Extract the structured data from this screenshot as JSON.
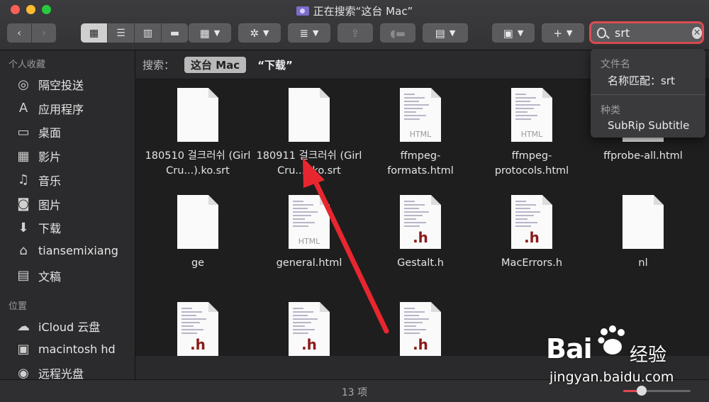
{
  "window": {
    "title": "正在搜索“这台 Mac”",
    "traffic_lights": [
      "#ff5f57",
      "#febc2e",
      "#28c840"
    ]
  },
  "toolbar": {
    "back_icon": "chevron-left",
    "forward_icon": "chevron-right",
    "view_modes": [
      "icon-view",
      "list-view",
      "column-view",
      "gallery-view"
    ],
    "active_view": "icon-view",
    "search": {
      "value": "srt",
      "placeholder": "搜索"
    }
  },
  "sidebar": {
    "favorites_header": "个人收藏",
    "favorites": [
      {
        "label": "隔空投送",
        "icon": "airdrop-icon",
        "glyph": "◎"
      },
      {
        "label": "应用程序",
        "icon": "applications-icon",
        "glyph": "A"
      },
      {
        "label": "桌面",
        "icon": "desktop-icon",
        "glyph": "▭"
      },
      {
        "label": "影片",
        "icon": "movies-icon",
        "glyph": "▦"
      },
      {
        "label": "音乐",
        "icon": "music-icon",
        "glyph": "♫"
      },
      {
        "label": "图片",
        "icon": "pictures-icon",
        "glyph": "◙"
      },
      {
        "label": "下载",
        "icon": "downloads-icon",
        "glyph": "⬇"
      },
      {
        "label": "tiansemixiang",
        "icon": "home-icon",
        "glyph": "⌂"
      },
      {
        "label": "文稿",
        "icon": "documents-icon",
        "glyph": "▤"
      }
    ],
    "locations_header": "位置",
    "locations": [
      {
        "label": "iCloud 云盘",
        "icon": "icloud-icon",
        "glyph": "☁"
      },
      {
        "label": "macintosh hd",
        "icon": "hard-disk-icon",
        "glyph": "▣"
      },
      {
        "label": "远程光盘",
        "icon": "optical-disc-icon",
        "glyph": "◉"
      }
    ]
  },
  "scope_bar": {
    "label": "搜索：",
    "active_scope": "这台 Mac",
    "other_scope": "“下载”"
  },
  "files": [
    {
      "name": "180510 걸크러쉬 (Girl Cru...).ko.srt",
      "kind": "blank"
    },
    {
      "name": "180911 걸크러쉬 (Girl Cru...).ko.srt",
      "kind": "blank"
    },
    {
      "name": "ffmpeg-formats.html",
      "kind": "html",
      "badge": "HTML"
    },
    {
      "name": "ffmpeg-protocols.html",
      "kind": "html",
      "badge": "HTML"
    },
    {
      "name": "ffprobe-all.html",
      "kind": "html",
      "badge": "HTML"
    },
    {
      "name": "ge",
      "kind": "blank"
    },
    {
      "name": "general.html",
      "kind": "html",
      "badge": "HTML"
    },
    {
      "name": "Gestalt.h",
      "kind": "header",
      "badge": ".h"
    },
    {
      "name": "MacErrors.h",
      "kind": "header",
      "badge": ".h"
    },
    {
      "name": "nl",
      "kind": "blank"
    },
    {
      "name": "",
      "kind": "header",
      "badge": ".h"
    },
    {
      "name": "",
      "kind": "header",
      "badge": ".h"
    },
    {
      "name": "",
      "kind": "header",
      "badge": ".h"
    }
  ],
  "status_bar": {
    "item_count": "13 项",
    "icon_size_level": 0.27
  },
  "search_popover": {
    "filename_header": "文件名",
    "filename_suggestion": "名称匹配：srt",
    "kind_header": "种类",
    "kind_suggestion": "SubRip Subtitle"
  },
  "watermark": {
    "brand": "Bai",
    "brand_tail": "经验",
    "url": "jingyan.baidu.com"
  },
  "colors": {
    "accent_red": "#e8262f",
    "search_outline": "#d94c52"
  }
}
